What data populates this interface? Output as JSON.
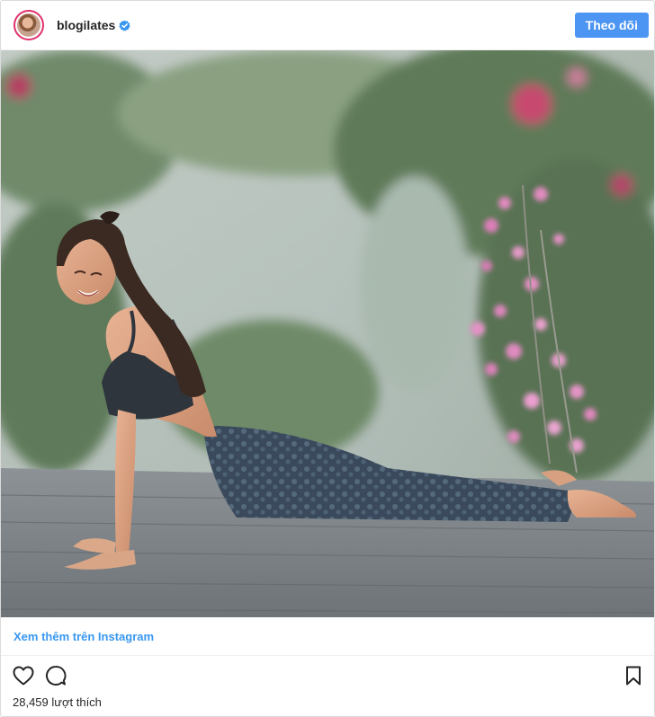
{
  "header": {
    "username": "blogilates",
    "follow_label": "Theo dõi"
  },
  "post": {
    "view_more_label": "Xem thêm trên Instagram",
    "likes_count": "28,459",
    "likes_suffix": "lượt thích"
  },
  "icons": {
    "verified": "verified-badge-icon",
    "like": "heart-icon",
    "comment": "comment-bubble-icon",
    "save": "bookmark-icon"
  },
  "colors": {
    "follow_button": "#4c95f2",
    "link": "#3897f0",
    "verified": "#3897f0"
  }
}
